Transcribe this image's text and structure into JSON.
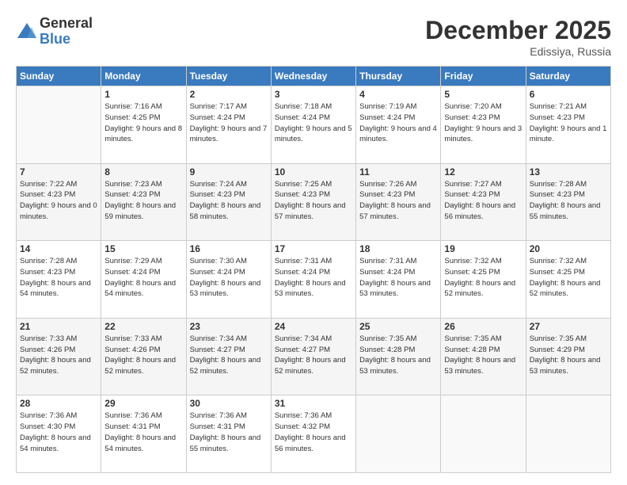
{
  "logo": {
    "general": "General",
    "blue": "Blue"
  },
  "title": "December 2025",
  "location": "Edissiya, Russia",
  "weekdays": [
    "Sunday",
    "Monday",
    "Tuesday",
    "Wednesday",
    "Thursday",
    "Friday",
    "Saturday"
  ],
  "weeks": [
    [
      {
        "day": "",
        "sunrise": "",
        "sunset": "",
        "daylight": ""
      },
      {
        "day": "1",
        "sunrise": "Sunrise: 7:16 AM",
        "sunset": "Sunset: 4:25 PM",
        "daylight": "Daylight: 9 hours and 8 minutes."
      },
      {
        "day": "2",
        "sunrise": "Sunrise: 7:17 AM",
        "sunset": "Sunset: 4:24 PM",
        "daylight": "Daylight: 9 hours and 7 minutes."
      },
      {
        "day": "3",
        "sunrise": "Sunrise: 7:18 AM",
        "sunset": "Sunset: 4:24 PM",
        "daylight": "Daylight: 9 hours and 5 minutes."
      },
      {
        "day": "4",
        "sunrise": "Sunrise: 7:19 AM",
        "sunset": "Sunset: 4:24 PM",
        "daylight": "Daylight: 9 hours and 4 minutes."
      },
      {
        "day": "5",
        "sunrise": "Sunrise: 7:20 AM",
        "sunset": "Sunset: 4:23 PM",
        "daylight": "Daylight: 9 hours and 3 minutes."
      },
      {
        "day": "6",
        "sunrise": "Sunrise: 7:21 AM",
        "sunset": "Sunset: 4:23 PM",
        "daylight": "Daylight: 9 hours and 1 minute."
      }
    ],
    [
      {
        "day": "7",
        "sunrise": "Sunrise: 7:22 AM",
        "sunset": "Sunset: 4:23 PM",
        "daylight": "Daylight: 9 hours and 0 minutes."
      },
      {
        "day": "8",
        "sunrise": "Sunrise: 7:23 AM",
        "sunset": "Sunset: 4:23 PM",
        "daylight": "Daylight: 8 hours and 59 minutes."
      },
      {
        "day": "9",
        "sunrise": "Sunrise: 7:24 AM",
        "sunset": "Sunset: 4:23 PM",
        "daylight": "Daylight: 8 hours and 58 minutes."
      },
      {
        "day": "10",
        "sunrise": "Sunrise: 7:25 AM",
        "sunset": "Sunset: 4:23 PM",
        "daylight": "Daylight: 8 hours and 57 minutes."
      },
      {
        "day": "11",
        "sunrise": "Sunrise: 7:26 AM",
        "sunset": "Sunset: 4:23 PM",
        "daylight": "Daylight: 8 hours and 57 minutes."
      },
      {
        "day": "12",
        "sunrise": "Sunrise: 7:27 AM",
        "sunset": "Sunset: 4:23 PM",
        "daylight": "Daylight: 8 hours and 56 minutes."
      },
      {
        "day": "13",
        "sunrise": "Sunrise: 7:28 AM",
        "sunset": "Sunset: 4:23 PM",
        "daylight": "Daylight: 8 hours and 55 minutes."
      }
    ],
    [
      {
        "day": "14",
        "sunrise": "Sunrise: 7:28 AM",
        "sunset": "Sunset: 4:23 PM",
        "daylight": "Daylight: 8 hours and 54 minutes."
      },
      {
        "day": "15",
        "sunrise": "Sunrise: 7:29 AM",
        "sunset": "Sunset: 4:24 PM",
        "daylight": "Daylight: 8 hours and 54 minutes."
      },
      {
        "day": "16",
        "sunrise": "Sunrise: 7:30 AM",
        "sunset": "Sunset: 4:24 PM",
        "daylight": "Daylight: 8 hours and 53 minutes."
      },
      {
        "day": "17",
        "sunrise": "Sunrise: 7:31 AM",
        "sunset": "Sunset: 4:24 PM",
        "daylight": "Daylight: 8 hours and 53 minutes."
      },
      {
        "day": "18",
        "sunrise": "Sunrise: 7:31 AM",
        "sunset": "Sunset: 4:24 PM",
        "daylight": "Daylight: 8 hours and 53 minutes."
      },
      {
        "day": "19",
        "sunrise": "Sunrise: 7:32 AM",
        "sunset": "Sunset: 4:25 PM",
        "daylight": "Daylight: 8 hours and 52 minutes."
      },
      {
        "day": "20",
        "sunrise": "Sunrise: 7:32 AM",
        "sunset": "Sunset: 4:25 PM",
        "daylight": "Daylight: 8 hours and 52 minutes."
      }
    ],
    [
      {
        "day": "21",
        "sunrise": "Sunrise: 7:33 AM",
        "sunset": "Sunset: 4:26 PM",
        "daylight": "Daylight: 8 hours and 52 minutes."
      },
      {
        "day": "22",
        "sunrise": "Sunrise: 7:33 AM",
        "sunset": "Sunset: 4:26 PM",
        "daylight": "Daylight: 8 hours and 52 minutes."
      },
      {
        "day": "23",
        "sunrise": "Sunrise: 7:34 AM",
        "sunset": "Sunset: 4:27 PM",
        "daylight": "Daylight: 8 hours and 52 minutes."
      },
      {
        "day": "24",
        "sunrise": "Sunrise: 7:34 AM",
        "sunset": "Sunset: 4:27 PM",
        "daylight": "Daylight: 8 hours and 52 minutes."
      },
      {
        "day": "25",
        "sunrise": "Sunrise: 7:35 AM",
        "sunset": "Sunset: 4:28 PM",
        "daylight": "Daylight: 8 hours and 53 minutes."
      },
      {
        "day": "26",
        "sunrise": "Sunrise: 7:35 AM",
        "sunset": "Sunset: 4:28 PM",
        "daylight": "Daylight: 8 hours and 53 minutes."
      },
      {
        "day": "27",
        "sunrise": "Sunrise: 7:35 AM",
        "sunset": "Sunset: 4:29 PM",
        "daylight": "Daylight: 8 hours and 53 minutes."
      }
    ],
    [
      {
        "day": "28",
        "sunrise": "Sunrise: 7:36 AM",
        "sunset": "Sunset: 4:30 PM",
        "daylight": "Daylight: 8 hours and 54 minutes."
      },
      {
        "day": "29",
        "sunrise": "Sunrise: 7:36 AM",
        "sunset": "Sunset: 4:31 PM",
        "daylight": "Daylight: 8 hours and 54 minutes."
      },
      {
        "day": "30",
        "sunrise": "Sunrise: 7:36 AM",
        "sunset": "Sunset: 4:31 PM",
        "daylight": "Daylight: 8 hours and 55 minutes."
      },
      {
        "day": "31",
        "sunrise": "Sunrise: 7:36 AM",
        "sunset": "Sunset: 4:32 PM",
        "daylight": "Daylight: 8 hours and 56 minutes."
      },
      {
        "day": "",
        "sunrise": "",
        "sunset": "",
        "daylight": ""
      },
      {
        "day": "",
        "sunrise": "",
        "sunset": "",
        "daylight": ""
      },
      {
        "day": "",
        "sunrise": "",
        "sunset": "",
        "daylight": ""
      }
    ]
  ]
}
